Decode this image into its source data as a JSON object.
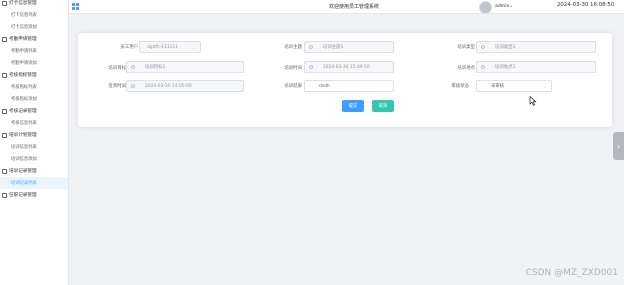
{
  "sidebar": {
    "groups": [
      {
        "label": "打卡信息管理",
        "items": [
          {
            "label": "打卡信息列表"
          },
          {
            "label": "打卡信息添加"
          }
        ]
      },
      {
        "label": "考勤申请管理",
        "items": [
          {
            "label": "考勤申请列表"
          },
          {
            "label": "考勤申请添加"
          }
        ]
      },
      {
        "label": "考核指标管理",
        "items": [
          {
            "label": "考核指标列表"
          },
          {
            "label": "考核指标添加"
          }
        ]
      },
      {
        "label": "考核记录管理",
        "items": [
          {
            "label": "考核信息列表"
          }
        ]
      },
      {
        "label": "培训计划管理",
        "items": [
          {
            "label": "培训信息列表"
          },
          {
            "label": "培训信息添加"
          }
        ]
      },
      {
        "label": "培训记录管理",
        "items": [
          {
            "label": "培训记录列表"
          }
        ]
      },
      {
        "label": "任职记录管理",
        "items": []
      }
    ],
    "active_item": "培训记录列表"
  },
  "header": {
    "welcome": "欢迎使用员工管理系统",
    "user": "admin",
    "datetime": "2024-03-30 16:08:50"
  },
  "form": {
    "employee_label": "员工用户",
    "employee_value": "dgdfh-111111",
    "topic_label": "培训主题",
    "topic_value": "培训主题1",
    "type_label": "培训类型",
    "type_value": "培训类型1",
    "goal_label": "培训目标",
    "goal_value": "培训目标1",
    "time_label": "培训时间",
    "time_value": "2024-03-30 15:49:50",
    "place_label": "培训地点",
    "place_value": "培训地点1",
    "signin_label": "签到时间",
    "signin_value": "2024-03-30 14:00:00",
    "result_label": "培训结果",
    "result_value": "dsdh",
    "audit_label": "审核状态",
    "audit_value": "未审核"
  },
  "buttons": {
    "confirm": "提交",
    "cancel": "取消"
  },
  "side_tab_icon": "chevron-right-icon",
  "watermark": "CSDN @MZ_ZXD001",
  "colors": {
    "primary": "#409eff",
    "cancel": "#36c6b0",
    "active_bg": "#ecf5ff"
  }
}
